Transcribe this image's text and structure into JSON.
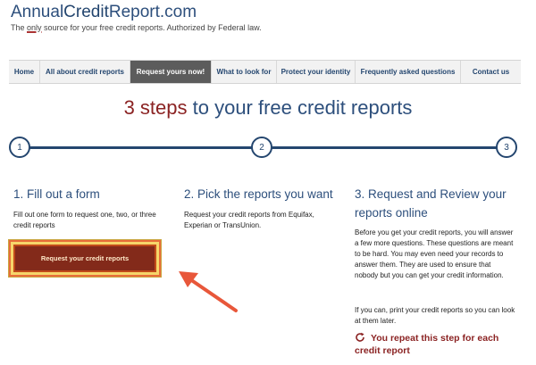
{
  "logo": {
    "part1": "Annual",
    "part2": "Credit",
    "part3": "Report.com"
  },
  "tagline": {
    "pre": "The ",
    "only": "only",
    "post": " source for your free credit reports. Authorized by Federal law."
  },
  "nav": {
    "items": [
      {
        "label": "Home"
      },
      {
        "label": "All about credit reports"
      },
      {
        "label": "Request yours now!"
      },
      {
        "label": "What to look for"
      },
      {
        "label": "Protect your identity"
      },
      {
        "label": "Frequently asked questions"
      },
      {
        "label": "Contact us"
      }
    ],
    "active_index": 2
  },
  "headline": {
    "accent": "3 steps",
    "rest": " to your free credit reports"
  },
  "steps": [
    {
      "number": "1",
      "title": "1. Fill out a form",
      "text": "Fill out one form to request one, two, or three credit reports"
    },
    {
      "number": "2",
      "title": "2. Pick the reports you want",
      "text": "Request your credit reports from Equifax, Experian or TransUnion."
    },
    {
      "number": "3",
      "title": "3. Request and Review your reports online",
      "text": "Before you get your credit reports, you will answer a few more questions. These questions are meant to be hard. You may even need your records to answer them. They are used to ensure that nobody but you can get your credit information.",
      "text2": "If you can, print your credit reports so you can look at them later."
    }
  ],
  "cta": {
    "label": "Request your credit reports"
  },
  "repeat_note": "You repeat this step for each credit report",
  "colors": {
    "navy": "#24466f",
    "accent_red": "#8b2323",
    "arrow": "#e8573a",
    "cta_bg": "#832a1a"
  },
  "icons": {
    "annotation": "arrow-pointer-icon",
    "repeat": "refresh-icon"
  }
}
